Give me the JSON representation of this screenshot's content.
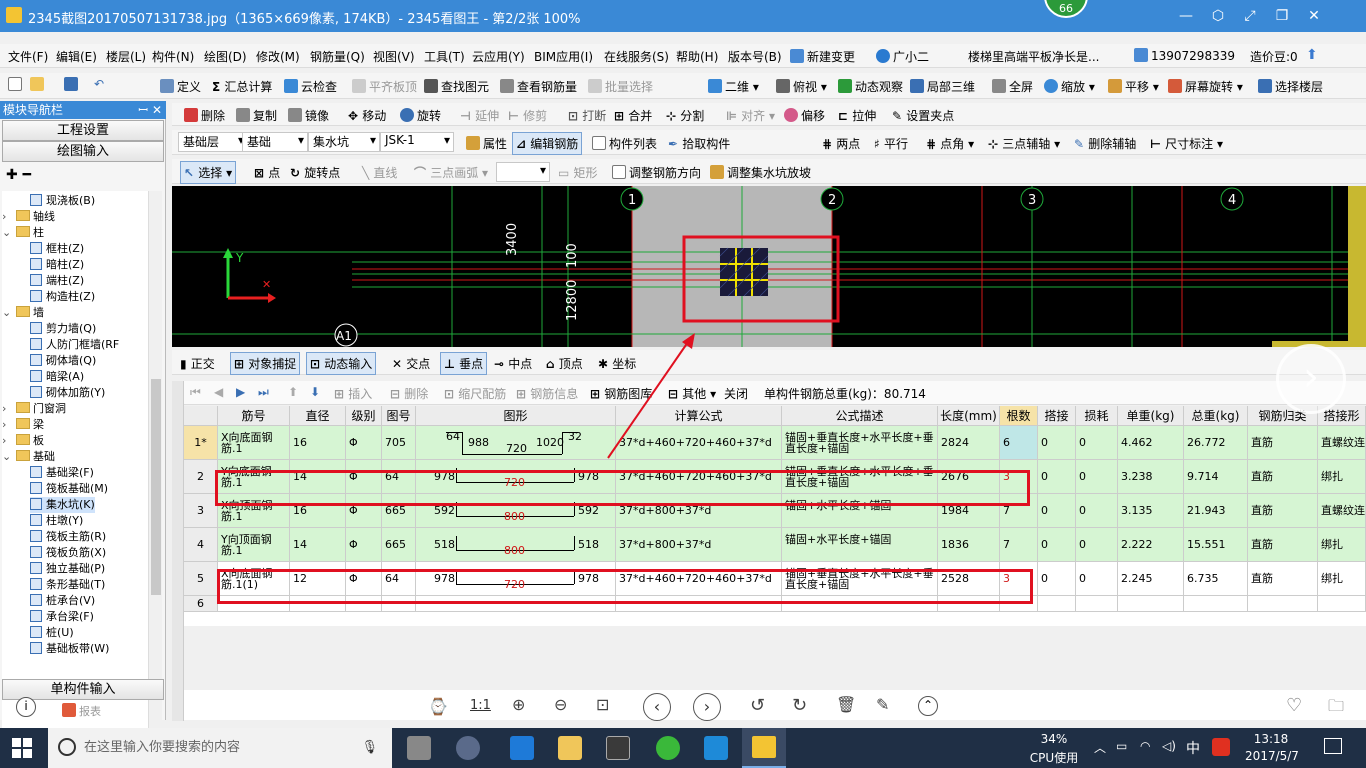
{
  "window": {
    "title": "2345截图20170507131738.jpg（1365×669像素, 174KB）- 2345看图王 - 第2/2张 100%",
    "badge": "66"
  },
  "menu": {
    "items": [
      "文件(F)",
      "编辑(E)",
      "楼层(L)",
      "构件(N)",
      "绘图(D)",
      "修改(M)",
      "钢筋量(Q)",
      "视图(V)",
      "工具(T)",
      "云应用(Y)",
      "BIM应用(I)",
      "在线服务(S)",
      "帮助(H)",
      "版本号(B)",
      "新建变更",
      "广小二"
    ],
    "ad_text": "楼梯里高端平板净长是...",
    "phone": "13907298339",
    "coins": "造价豆:0"
  },
  "toolbar1": {
    "items": [
      "定义",
      "汇总计算",
      "云检查",
      "平齐板顶",
      "查找图元",
      "查看钢筋量",
      "批量选择",
      "二维",
      "俯视",
      "动态观察",
      "局部三维",
      "全屏",
      "缩放",
      "平移",
      "屏幕旋转",
      "选择楼层"
    ]
  },
  "toolbar2": {
    "items": [
      "删除",
      "复制",
      "镜像",
      "移动",
      "旋转",
      "延伸",
      "修剪",
      "打断",
      "合并",
      "分割",
      "对齐",
      "偏移",
      "拉伸",
      "设置夹点"
    ]
  },
  "toolbar3": {
    "floor": "基础层",
    "cat": "基础",
    "type": "集水坑",
    "name": "JSK-1",
    "items": [
      "属性",
      "编辑钢筋",
      "构件列表",
      "拾取构件",
      "两点",
      "平行",
      "点角",
      "三点辅轴",
      "删除辅轴",
      "尺寸标注"
    ]
  },
  "toolbar4": {
    "items": [
      "选择",
      "点",
      "旋转点",
      "直线",
      "三点画弧",
      "矩形",
      "调整钢筋方向",
      "调整集水坑放坡"
    ]
  },
  "sidebar": {
    "header": "模块导航栏",
    "btn1": "工程设置",
    "btn2": "绘图输入",
    "btn_bottom": "单构件输入",
    "report": "报表",
    "tree": [
      {
        "label": "现浇板(B)",
        "kind": "item",
        "level": 2
      },
      {
        "label": "轴线",
        "kind": "folder",
        "level": 1
      },
      {
        "label": "柱",
        "kind": "folder",
        "level": 1
      },
      {
        "label": "框柱(Z)",
        "kind": "item",
        "level": 2
      },
      {
        "label": "暗柱(Z)",
        "kind": "item",
        "level": 2
      },
      {
        "label": "端柱(Z)",
        "kind": "item",
        "level": 2
      },
      {
        "label": "构造柱(Z)",
        "kind": "item",
        "level": 2
      },
      {
        "label": "墙",
        "kind": "folder",
        "level": 1
      },
      {
        "label": "剪力墙(Q)",
        "kind": "item",
        "level": 2
      },
      {
        "label": "人防门框墙(RF",
        "kind": "item",
        "level": 2
      },
      {
        "label": "砌体墙(Q)",
        "kind": "item",
        "level": 2
      },
      {
        "label": "暗梁(A)",
        "kind": "item",
        "level": 2
      },
      {
        "label": "砌体加筋(Y)",
        "kind": "item",
        "level": 2
      },
      {
        "label": "门窗洞",
        "kind": "folder",
        "level": 1
      },
      {
        "label": "梁",
        "kind": "folder",
        "level": 1
      },
      {
        "label": "板",
        "kind": "folder",
        "level": 1
      },
      {
        "label": "基础",
        "kind": "folder",
        "level": 1
      },
      {
        "label": "基础梁(F)",
        "kind": "item",
        "level": 2
      },
      {
        "label": "筏板基础(M)",
        "kind": "item",
        "level": 2
      },
      {
        "label": "集水坑(K)",
        "kind": "item",
        "level": 2,
        "selected": true
      },
      {
        "label": "柱墩(Y)",
        "kind": "item",
        "level": 2
      },
      {
        "label": "筏板主筋(R)",
        "kind": "item",
        "level": 2
      },
      {
        "label": "筏板负筋(X)",
        "kind": "item",
        "level": 2
      },
      {
        "label": "独立基础(P)",
        "kind": "item",
        "level": 2
      },
      {
        "label": "条形基础(T)",
        "kind": "item",
        "level": 2
      },
      {
        "label": "桩承台(V)",
        "kind": "item",
        "level": 2
      },
      {
        "label": "承台梁(F)",
        "kind": "item",
        "level": 2
      },
      {
        "label": "桩(U)",
        "kind": "item",
        "level": 2
      },
      {
        "label": "基础板带(W)",
        "kind": "item",
        "level": 2
      }
    ]
  },
  "cad": {
    "axes": [
      "1",
      "2",
      "3",
      "4"
    ],
    "bottom_axis": "A1",
    "dims": [
      "3400",
      "100",
      "12800"
    ],
    "y_label": "Y"
  },
  "snapbar": {
    "items": [
      "正交",
      "对象捕捉",
      "动态输入",
      "交点",
      "垂点",
      "中点",
      "顶点",
      "坐标"
    ]
  },
  "gridtoolbar": {
    "items": [
      "插入",
      "删除",
      "缩尺配筋",
      "钢筋信息",
      "钢筋图库",
      "其他",
      "关闭"
    ],
    "total_label": "单构件钢筋总重(kg)：80.714"
  },
  "table": {
    "headers": [
      "",
      "筋号",
      "直径(mm)",
      "级别",
      "图号",
      "图形",
      "计算公式",
      "公式描述",
      "长度(mm)",
      "根数",
      "搭接",
      "损耗(%)",
      "单重(kg)",
      "总重(kg)",
      "钢筋归类",
      "搭接形"
    ],
    "rows": [
      {
        "no": "1*",
        "name": "X向底面钢筋.1",
        "dia": "16",
        "grade": "Φ",
        "fig": "705",
        "shape": {
          "a": "64",
          "b": "988",
          "c": "720",
          "d": "1020",
          "e": "32"
        },
        "formula": "37*d+460+720+460+37*d",
        "desc": "锚固+垂直长度+水平长度+垂直长度+锚固",
        "len": "2824",
        "count": "6",
        "lap": "0",
        "loss": "0",
        "unit": "4.462",
        "total": "26.772",
        "cat": "直筋",
        "laptype": "直螺纹连"
      },
      {
        "no": "2",
        "name": "Y向底面钢筋.1",
        "dia": "14",
        "grade": "Φ",
        "fig": "64",
        "shape": {
          "a": "978",
          "b": "720",
          "c": "978"
        },
        "formula": "37*d+460+720+460+37*d",
        "desc": "锚固+垂直长度+水平长度+垂直长度+锚固",
        "len": "2676",
        "count": "3",
        "lap": "0",
        "loss": "0",
        "unit": "3.238",
        "total": "9.714",
        "cat": "直筋",
        "laptype": "绑扎"
      },
      {
        "no": "3",
        "name": "X向顶面钢筋.1",
        "dia": "16",
        "grade": "Φ",
        "fig": "665",
        "shape": {
          "a": "592",
          "b": "800",
          "c": "592"
        },
        "formula": "37*d+800+37*d",
        "desc": "锚固+水平长度+锚固",
        "len": "1984",
        "count": "7",
        "lap": "0",
        "loss": "0",
        "unit": "3.135",
        "total": "21.943",
        "cat": "直筋",
        "laptype": "直螺纹连"
      },
      {
        "no": "4",
        "name": "Y向顶面钢筋.1",
        "dia": "14",
        "grade": "Φ",
        "fig": "665",
        "shape": {
          "a": "518",
          "b": "800",
          "c": "518"
        },
        "formula": "37*d+800+37*d",
        "desc": "锚固+水平长度+锚固",
        "len": "1836",
        "count": "7",
        "lap": "0",
        "loss": "0",
        "unit": "2.222",
        "total": "15.551",
        "cat": "直筋",
        "laptype": "绑扎"
      },
      {
        "no": "5",
        "name": "X向底面钢筋.1(1)",
        "dia": "12",
        "grade": "Φ",
        "fig": "64",
        "shape": {
          "a": "978",
          "b": "720",
          "c": "978"
        },
        "formula": "37*d+460+720+460+37*d",
        "desc": "锚固+垂直长度+水平长度+垂直长度+锚固",
        "len": "2528",
        "count": "3",
        "lap": "0",
        "loss": "0",
        "unit": "2.245",
        "total": "6.735",
        "cat": "直筋",
        "laptype": "绑扎"
      },
      {
        "no": "6"
      }
    ]
  },
  "viewer": {
    "zoom_label": "1:1"
  },
  "taskbar": {
    "search_placeholder": "在这里输入你要搜索的内容",
    "cpu": "34%",
    "cpu_label": "CPU使用",
    "ime": "中",
    "time": "13:18",
    "date": "2017/5/7"
  }
}
